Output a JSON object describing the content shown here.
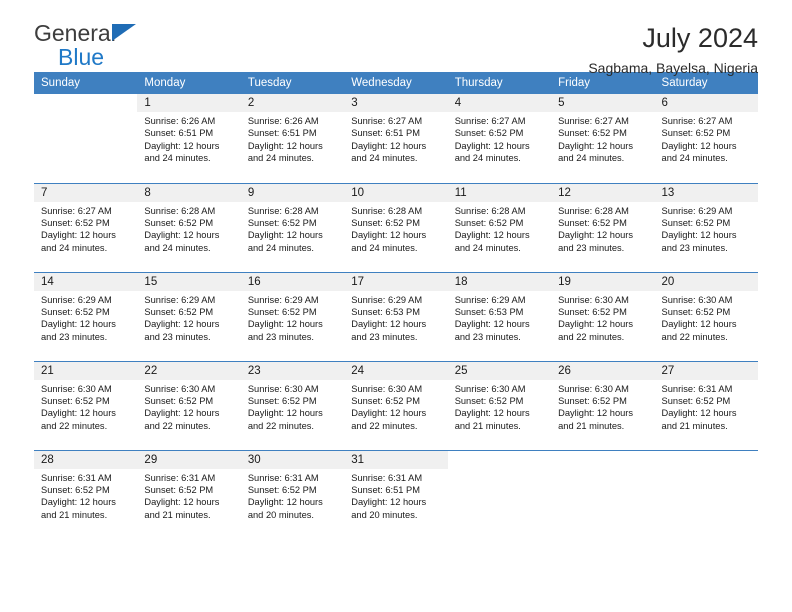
{
  "brand": {
    "name_top": "General",
    "name_bottom": "Blue",
    "triangle_color": "#1f6cb5",
    "blue_color": "#2079c7"
  },
  "header": {
    "title": "July 2024",
    "subtitle": "Sagbama, Bayelsa, Nigeria"
  },
  "theme": {
    "header_bg": "#3f80c0",
    "daynum_bg": "#f0f0f0",
    "grid_line": "#3f80c0"
  },
  "weekday_headers": [
    "Sunday",
    "Monday",
    "Tuesday",
    "Wednesday",
    "Thursday",
    "Friday",
    "Saturday"
  ],
  "weeks": [
    [
      {
        "day": "",
        "empty": true
      },
      {
        "day": "1",
        "sunrise": "Sunrise: 6:26 AM",
        "sunset": "Sunset: 6:51 PM",
        "daylight_line1": "Daylight: 12 hours",
        "daylight_line2": "and 24 minutes."
      },
      {
        "day": "2",
        "sunrise": "Sunrise: 6:26 AM",
        "sunset": "Sunset: 6:51 PM",
        "daylight_line1": "Daylight: 12 hours",
        "daylight_line2": "and 24 minutes."
      },
      {
        "day": "3",
        "sunrise": "Sunrise: 6:27 AM",
        "sunset": "Sunset: 6:51 PM",
        "daylight_line1": "Daylight: 12 hours",
        "daylight_line2": "and 24 minutes."
      },
      {
        "day": "4",
        "sunrise": "Sunrise: 6:27 AM",
        "sunset": "Sunset: 6:52 PM",
        "daylight_line1": "Daylight: 12 hours",
        "daylight_line2": "and 24 minutes."
      },
      {
        "day": "5",
        "sunrise": "Sunrise: 6:27 AM",
        "sunset": "Sunset: 6:52 PM",
        "daylight_line1": "Daylight: 12 hours",
        "daylight_line2": "and 24 minutes."
      },
      {
        "day": "6",
        "sunrise": "Sunrise: 6:27 AM",
        "sunset": "Sunset: 6:52 PM",
        "daylight_line1": "Daylight: 12 hours",
        "daylight_line2": "and 24 minutes."
      }
    ],
    [
      {
        "day": "7",
        "sunrise": "Sunrise: 6:27 AM",
        "sunset": "Sunset: 6:52 PM",
        "daylight_line1": "Daylight: 12 hours",
        "daylight_line2": "and 24 minutes."
      },
      {
        "day": "8",
        "sunrise": "Sunrise: 6:28 AM",
        "sunset": "Sunset: 6:52 PM",
        "daylight_line1": "Daylight: 12 hours",
        "daylight_line2": "and 24 minutes."
      },
      {
        "day": "9",
        "sunrise": "Sunrise: 6:28 AM",
        "sunset": "Sunset: 6:52 PM",
        "daylight_line1": "Daylight: 12 hours",
        "daylight_line2": "and 24 minutes."
      },
      {
        "day": "10",
        "sunrise": "Sunrise: 6:28 AM",
        "sunset": "Sunset: 6:52 PM",
        "daylight_line1": "Daylight: 12 hours",
        "daylight_line2": "and 24 minutes."
      },
      {
        "day": "11",
        "sunrise": "Sunrise: 6:28 AM",
        "sunset": "Sunset: 6:52 PM",
        "daylight_line1": "Daylight: 12 hours",
        "daylight_line2": "and 24 minutes."
      },
      {
        "day": "12",
        "sunrise": "Sunrise: 6:28 AM",
        "sunset": "Sunset: 6:52 PM",
        "daylight_line1": "Daylight: 12 hours",
        "daylight_line2": "and 23 minutes."
      },
      {
        "day": "13",
        "sunrise": "Sunrise: 6:29 AM",
        "sunset": "Sunset: 6:52 PM",
        "daylight_line1": "Daylight: 12 hours",
        "daylight_line2": "and 23 minutes."
      }
    ],
    [
      {
        "day": "14",
        "sunrise": "Sunrise: 6:29 AM",
        "sunset": "Sunset: 6:52 PM",
        "daylight_line1": "Daylight: 12 hours",
        "daylight_line2": "and 23 minutes."
      },
      {
        "day": "15",
        "sunrise": "Sunrise: 6:29 AM",
        "sunset": "Sunset: 6:52 PM",
        "daylight_line1": "Daylight: 12 hours",
        "daylight_line2": "and 23 minutes."
      },
      {
        "day": "16",
        "sunrise": "Sunrise: 6:29 AM",
        "sunset": "Sunset: 6:52 PM",
        "daylight_line1": "Daylight: 12 hours",
        "daylight_line2": "and 23 minutes."
      },
      {
        "day": "17",
        "sunrise": "Sunrise: 6:29 AM",
        "sunset": "Sunset: 6:53 PM",
        "daylight_line1": "Daylight: 12 hours",
        "daylight_line2": "and 23 minutes."
      },
      {
        "day": "18",
        "sunrise": "Sunrise: 6:29 AM",
        "sunset": "Sunset: 6:53 PM",
        "daylight_line1": "Daylight: 12 hours",
        "daylight_line2": "and 23 minutes."
      },
      {
        "day": "19",
        "sunrise": "Sunrise: 6:30 AM",
        "sunset": "Sunset: 6:52 PM",
        "daylight_line1": "Daylight: 12 hours",
        "daylight_line2": "and 22 minutes."
      },
      {
        "day": "20",
        "sunrise": "Sunrise: 6:30 AM",
        "sunset": "Sunset: 6:52 PM",
        "daylight_line1": "Daylight: 12 hours",
        "daylight_line2": "and 22 minutes."
      }
    ],
    [
      {
        "day": "21",
        "sunrise": "Sunrise: 6:30 AM",
        "sunset": "Sunset: 6:52 PM",
        "daylight_line1": "Daylight: 12 hours",
        "daylight_line2": "and 22 minutes."
      },
      {
        "day": "22",
        "sunrise": "Sunrise: 6:30 AM",
        "sunset": "Sunset: 6:52 PM",
        "daylight_line1": "Daylight: 12 hours",
        "daylight_line2": "and 22 minutes."
      },
      {
        "day": "23",
        "sunrise": "Sunrise: 6:30 AM",
        "sunset": "Sunset: 6:52 PM",
        "daylight_line1": "Daylight: 12 hours",
        "daylight_line2": "and 22 minutes."
      },
      {
        "day": "24",
        "sunrise": "Sunrise: 6:30 AM",
        "sunset": "Sunset: 6:52 PM",
        "daylight_line1": "Daylight: 12 hours",
        "daylight_line2": "and 22 minutes."
      },
      {
        "day": "25",
        "sunrise": "Sunrise: 6:30 AM",
        "sunset": "Sunset: 6:52 PM",
        "daylight_line1": "Daylight: 12 hours",
        "daylight_line2": "and 21 minutes."
      },
      {
        "day": "26",
        "sunrise": "Sunrise: 6:30 AM",
        "sunset": "Sunset: 6:52 PM",
        "daylight_line1": "Daylight: 12 hours",
        "daylight_line2": "and 21 minutes."
      },
      {
        "day": "27",
        "sunrise": "Sunrise: 6:31 AM",
        "sunset": "Sunset: 6:52 PM",
        "daylight_line1": "Daylight: 12 hours",
        "daylight_line2": "and 21 minutes."
      }
    ],
    [
      {
        "day": "28",
        "sunrise": "Sunrise: 6:31 AM",
        "sunset": "Sunset: 6:52 PM",
        "daylight_line1": "Daylight: 12 hours",
        "daylight_line2": "and 21 minutes."
      },
      {
        "day": "29",
        "sunrise": "Sunrise: 6:31 AM",
        "sunset": "Sunset: 6:52 PM",
        "daylight_line1": "Daylight: 12 hours",
        "daylight_line2": "and 21 minutes."
      },
      {
        "day": "30",
        "sunrise": "Sunrise: 6:31 AM",
        "sunset": "Sunset: 6:52 PM",
        "daylight_line1": "Daylight: 12 hours",
        "daylight_line2": "and 20 minutes."
      },
      {
        "day": "31",
        "sunrise": "Sunrise: 6:31 AM",
        "sunset": "Sunset: 6:51 PM",
        "daylight_line1": "Daylight: 12 hours",
        "daylight_line2": "and 20 minutes."
      },
      {
        "day": "",
        "empty": true
      },
      {
        "day": "",
        "empty": true
      },
      {
        "day": "",
        "empty": true
      }
    ]
  ]
}
